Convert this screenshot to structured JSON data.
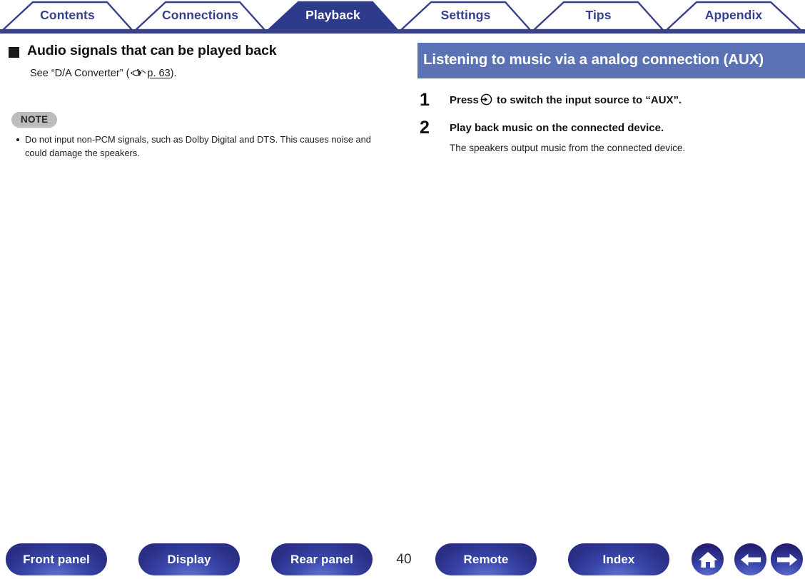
{
  "tabs": [
    {
      "label": "Contents",
      "active": false
    },
    {
      "label": "Connections",
      "active": false
    },
    {
      "label": "Playback",
      "active": true
    },
    {
      "label": "Settings",
      "active": false
    },
    {
      "label": "Tips",
      "active": false
    },
    {
      "label": "Appendix",
      "active": false
    }
  ],
  "left_column": {
    "heading": "Audio signals that can be played back",
    "body_prefix": "See “D/A Converter” (",
    "xref_link": "p. 63",
    "body_suffix": ").",
    "note_badge": "NOTE",
    "notes": [
      "Do not input non-PCM signals, such as Dolby Digital and DTS. This causes noise and could damage the speakers."
    ]
  },
  "right_column": {
    "section_title": "Listening to music via a analog connection (AUX)",
    "steps": [
      {
        "number": "1",
        "title_prefix": "Press",
        "title_suffix": "to switch the input source to “AUX”.",
        "sub": ""
      },
      {
        "number": "2",
        "title_prefix": "Play back music on the connected device.",
        "title_suffix": "",
        "sub": "The speakers output music from the connected device."
      }
    ]
  },
  "footer": {
    "buttons": [
      {
        "label": "Front panel"
      },
      {
        "label": "Display"
      },
      {
        "label": "Rear panel"
      },
      {
        "label": "Remote"
      },
      {
        "label": "Index"
      }
    ],
    "page_number": "40",
    "icons": [
      {
        "name": "home-icon"
      },
      {
        "name": "arrow-left-icon"
      },
      {
        "name": "arrow-right-icon"
      }
    ]
  },
  "colors": {
    "navy": "#36408c",
    "active_tab": "#2e3a8c",
    "section_header": "#5b73b5",
    "note_gray": "#bcbcbc"
  }
}
